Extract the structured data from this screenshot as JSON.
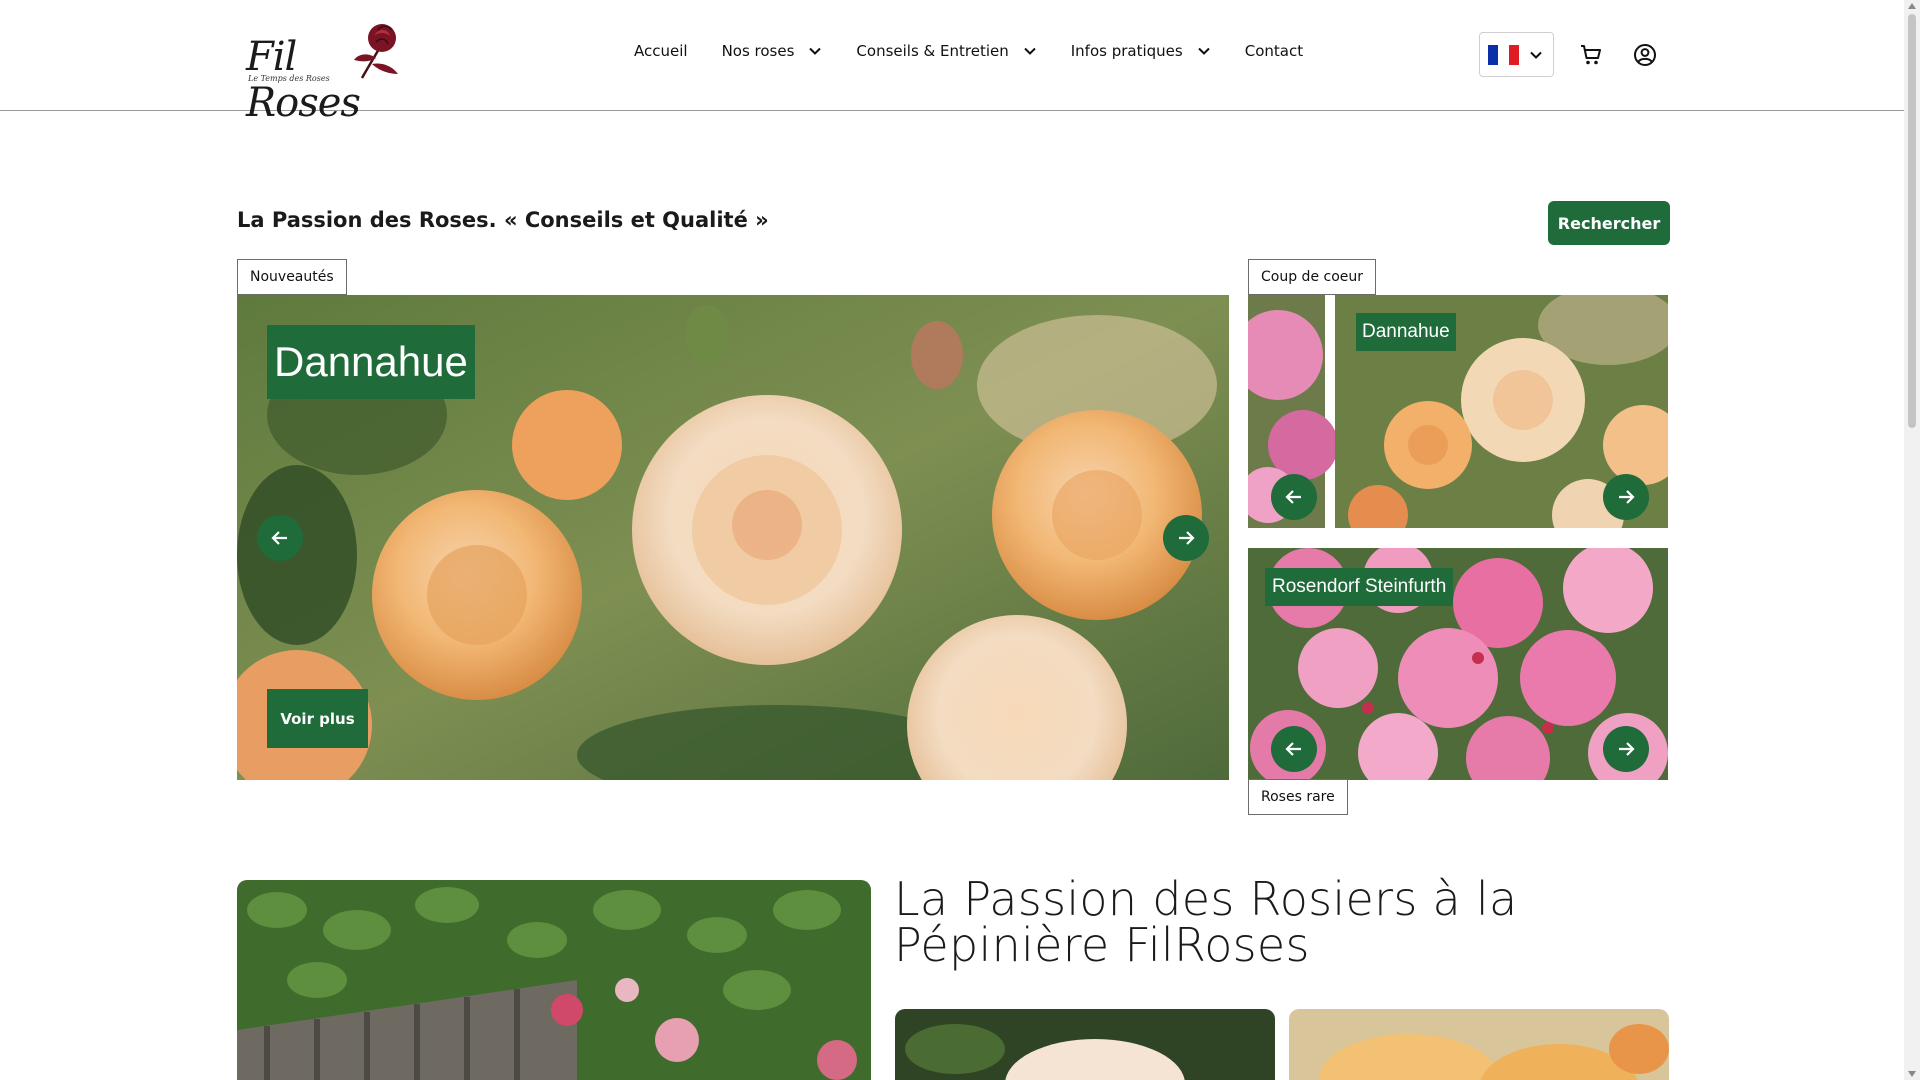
{
  "header": {
    "logo_text": "Fil Roses",
    "logo_tagline": "Le Temps des Roses",
    "nav": [
      {
        "label": "Accueil",
        "has_dropdown": false
      },
      {
        "label": "Nos roses",
        "has_dropdown": true
      },
      {
        "label": "Conseils & Entretien",
        "has_dropdown": true
      },
      {
        "label": "Infos pratiques",
        "has_dropdown": true
      },
      {
        "label": "Contact",
        "has_dropdown": false
      }
    ],
    "language": "fr",
    "icons": [
      "chevron-down-icon",
      "cart-icon",
      "account-icon"
    ]
  },
  "hero": {
    "tagline": "La Passion des Roses. « Conseils et Qualité »",
    "search_label": "Rechercher",
    "nouveautes": {
      "tab_label": "Nouveautés",
      "title": "Dannahue",
      "cta_label": "Voir plus"
    },
    "coup_de_coeur": {
      "tab_label": "Coup de coeur",
      "title": "Dannahue"
    },
    "roses_rare": {
      "tab_label": "Roses rare",
      "title": "Rosendorf Steinfurth"
    }
  },
  "section2": {
    "title": "La Passion des Rosiers à la Pépinière FilRoses"
  },
  "colors": {
    "brand_green": "#1f6b3a",
    "logo_rose": "#7a1424",
    "flag": [
      "#0b2fa8",
      "#ffffff",
      "#e01b24"
    ]
  }
}
